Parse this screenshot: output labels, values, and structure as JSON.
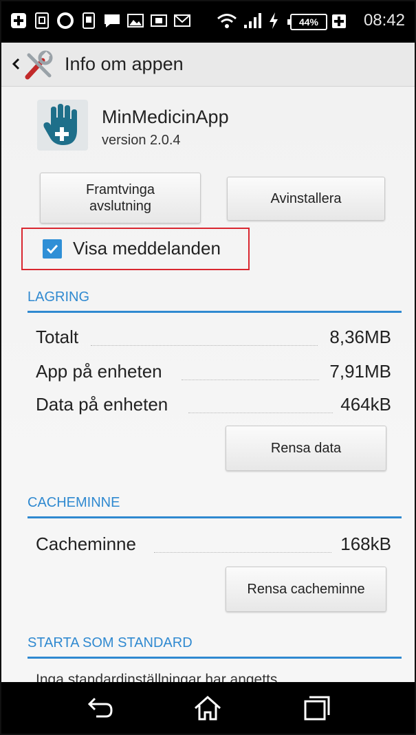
{
  "status_bar": {
    "time": "08:42",
    "battery": "44%",
    "icons": [
      "medical-cross-icon",
      "sim-icon",
      "circle-icon",
      "phone-icon",
      "chat-icon",
      "image-icon",
      "card-icon",
      "mail-icon",
      "wifi-icon",
      "signal-icon",
      "charging-icon",
      "battery-icon",
      "plus-box-icon"
    ]
  },
  "action_bar": {
    "title": "Info om appen",
    "back_icon": "chevron-left-icon",
    "settings_icon": "tools-icon"
  },
  "app": {
    "name": "MinMedicinApp",
    "version": "version 2.0.4",
    "icon": "hand-plus-icon"
  },
  "buttons": {
    "force_stop": "Framtvinga avslutning",
    "uninstall": "Avinstallera",
    "clear_data": "Rensa data",
    "clear_cache": "Rensa cacheminne"
  },
  "notifications": {
    "label": "Visa meddelanden",
    "checked": true
  },
  "storage": {
    "heading": "LAGRING",
    "rows": [
      {
        "label": "Totalt",
        "value": "8,36MB"
      },
      {
        "label": "App på enheten",
        "value": "7,91MB"
      },
      {
        "label": "Data på enheten",
        "value": "464kB"
      }
    ]
  },
  "cache": {
    "heading": "CACHEMINNE",
    "rows": [
      {
        "label": "Cacheminne",
        "value": "168kB"
      }
    ]
  },
  "defaults": {
    "heading": "STARTA SOM STANDARD",
    "text": "Inga standardinställningar har angetts"
  },
  "nav_bar": {
    "icons": [
      "back-icon",
      "home-icon",
      "recent-apps-icon"
    ]
  },
  "colors": {
    "accent": "#2f89d0",
    "highlight_border": "#d9262f",
    "checkbox": "#2f8fd6"
  }
}
